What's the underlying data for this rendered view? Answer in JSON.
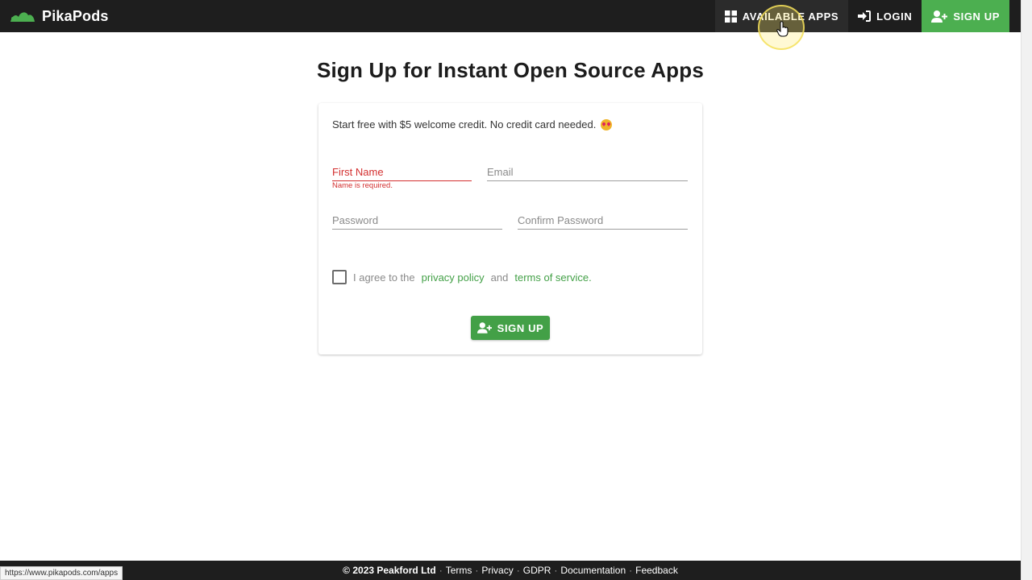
{
  "header": {
    "brand": "PikaPods",
    "nav": {
      "apps_label": "AVAILABLE APPS",
      "login_label": "LOGIN",
      "signup_label": "SIGN UP"
    }
  },
  "main": {
    "title": "Sign Up for Instant Open Source Apps",
    "intro": "Start free with $5 welcome credit. No credit card needed.",
    "form": {
      "first_name_placeholder": "First Name",
      "first_name_error": "Name is required.",
      "email_placeholder": "Email",
      "password_placeholder": "Password",
      "confirm_password_placeholder": "Confirm Password",
      "agree_prefix": "I agree to the",
      "privacy_link": "privacy policy",
      "agree_and": "and",
      "terms_link": "terms of service.",
      "submit_label": "SIGN UP"
    }
  },
  "footer": {
    "copyright": "© 2023 Peakford Ltd",
    "links": [
      "Terms",
      "Privacy",
      "GDPR",
      "Documentation",
      "Feedback"
    ]
  },
  "status_bar": {
    "url": "https://www.pikapods.com/apps"
  },
  "colors": {
    "accent": "#43a047",
    "topbar": "#1e1e1e",
    "error": "#d32f2f"
  }
}
